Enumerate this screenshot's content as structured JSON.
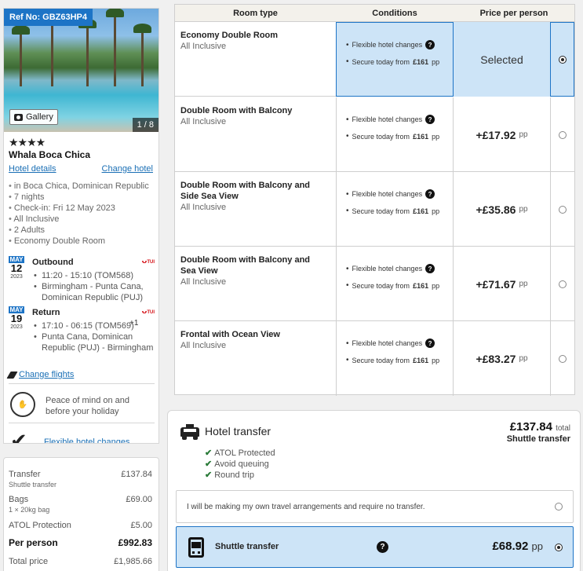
{
  "booking": {
    "ref": "Ref No: GBZ63HP4",
    "gallery_label": "Gallery",
    "photo_counter": "1 / 8",
    "stars": "★★★★",
    "hotel_name": "Whala Boca Chica",
    "hotel_details_link": "Hotel details",
    "change_hotel_link": "Change hotel",
    "info": [
      "in Boca Chica, Dominican Republic",
      "7 nights",
      "Check-in: Fri 12 May 2023",
      "All Inclusive",
      "2 Adults",
      "Economy Double Room"
    ],
    "outbound": {
      "month": "MAY",
      "day": "12",
      "year": "2023",
      "title": "Outbound",
      "airline": "TUI",
      "time": "11:20 - 15:10 (TOM568)",
      "route": "Birmingham - Punta Cana, Dominican Republic (PUJ)"
    },
    "return": {
      "month": "MAY",
      "day": "19",
      "year": "2023",
      "title": "Return",
      "airline": "TUI",
      "time": "17:10 - 06:15 (TOM569)",
      "plus_day": "+1",
      "route": "Punta Cana, Dominican Republic (PUJ) - Birmingham"
    },
    "change_flights_link": "Change flights",
    "peace_text": "Peace of mind on and before your holiday",
    "flexible_changes_link": "Flexible hotel changes"
  },
  "price_summary": {
    "transfer_label": "Transfer",
    "transfer_sub": "Shuttle transfer",
    "transfer_value": "£137.84",
    "bags_label": "Bags",
    "bags_sub": "1 × 20kg bag",
    "bags_value": "£69.00",
    "atol_label": "ATOL Protection",
    "atol_value": "£5.00",
    "per_person_label": "Per person",
    "per_person_value": "£992.83",
    "total_label": "Total price",
    "total_value": "£1,985.66"
  },
  "room_table": {
    "headers": {
      "room_type": "Room type",
      "conditions": "Conditions",
      "price": "Price per person"
    },
    "cond_flex": "Flexible hotel changes",
    "cond_secure_prefix": "Secure today from",
    "cond_secure_amount": "£161",
    "cond_secure_suffix": "pp",
    "pp": "pp",
    "rows": [
      {
        "name": "Economy Double Room",
        "board": "All Inclusive",
        "price": "Selected",
        "selected": true
      },
      {
        "name": "Double Room with Balcony",
        "board": "All Inclusive",
        "price": "+£17.92",
        "selected": false
      },
      {
        "name": "Double Room with Balcony and Side Sea View",
        "board": "All Inclusive",
        "price": "+£35.86",
        "selected": false
      },
      {
        "name": "Double Room with Balcony and Sea View",
        "board": "All Inclusive",
        "price": "+£71.67",
        "selected": false
      },
      {
        "name": "Frontal with Ocean View",
        "board": "All Inclusive",
        "price": "+£83.27",
        "selected": false
      }
    ]
  },
  "transfer": {
    "title": "Hotel transfer",
    "total_amount": "£137.84",
    "total_label": "total",
    "kind": "Shuttle transfer",
    "features": [
      "ATOL Protected",
      "Avoid queuing",
      "Round trip"
    ],
    "own_arrangements": "I will be making my own travel arrangements and require no transfer.",
    "shuttle_label": "Shuttle transfer",
    "shuttle_price": "£68.92",
    "shuttle_pp": "pp"
  },
  "colors": {
    "accent": "#1d74c6",
    "selected_bg": "#cde4f7",
    "tui_red": "#d40e14",
    "check_green": "#2a7a38"
  }
}
